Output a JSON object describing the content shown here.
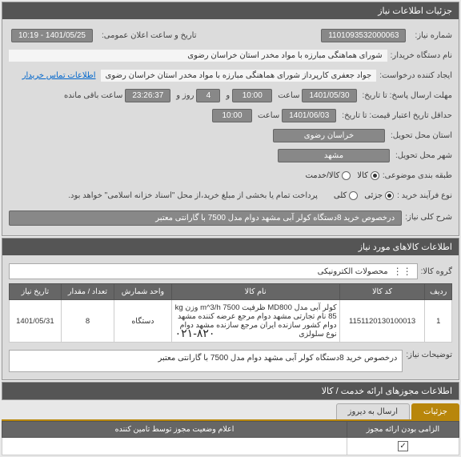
{
  "main_panel": {
    "title": "جزئیات اطلاعات نیاز"
  },
  "info": {
    "need_no_label": "شماره نیاز:",
    "need_no": "1101093532000063",
    "announce_label": "تاریخ و ساعت اعلان عمومی:",
    "announce_value": "1401/05/25 - 10:19",
    "buyer_label": "نام دستگاه خریدار:",
    "buyer_value": "شورای هماهنگی مبارزه با مواد مخدر استان خراسان رضوی",
    "creator_label": "ایجاد کننده درخواست:",
    "creator_value": "جواد جعفری کارپرداز شورای هماهنگی مبارزه با مواد مخدر استان خراسان رضوی",
    "contact_link": "اطلاعات تماس خریدار",
    "deadline_label": "مهلت ارسال پاسخ: تا تاریخ:",
    "deadline_date": "1401/05/30",
    "time_label": "ساعت",
    "deadline_time": "10:00",
    "days_left_pre": "و",
    "days_left": "4",
    "days_left_post": "روز و",
    "countdown": "23:26:37",
    "countdown_post": "ساعت باقی مانده",
    "credit_label": "حداقل تاریخ اعتبار قیمت: تا تاریخ:",
    "credit_date": "1401/06/03",
    "credit_time": "10:00",
    "province_label": "استان محل تحویل:",
    "province": "خراسان رضوی",
    "city_label": "شهر محل تحویل:",
    "city": "مشهد",
    "classify_label": "طبقه بندی موضوعی:",
    "classify_options": {
      "goods": "کالا",
      "service": "کالا/خدمت"
    },
    "buy_type_label": "نوع فرآیند خرید :",
    "buy_type_options": {
      "partial": "جزئی",
      "full": "کلی"
    },
    "buy_type_note": "پرداخت تمام یا بخشی از مبلغ خرید،از محل \"اسناد خزانه اسلامی\" خواهد بود.",
    "desc_label": "شرح کلی نیاز:",
    "desc_value": "درخصوص خرید 8دستگاه کولر آبی مشهد دوام  مدل 7500 با گارانتی معتبر"
  },
  "items_panel": {
    "title": "اطلاعات کالاهای مورد نیاز",
    "group_label": "گروه کالا:",
    "group_value": "محصولات الکترونیکی",
    "columns": {
      "row": "ردیف",
      "code": "کد کالا",
      "name": "نام کالا",
      "unit": "واحد شمارش",
      "qty": "تعداد / مقدار",
      "date": "تاریخ نیاز"
    },
    "rows": [
      {
        "row": "1",
        "code": "1151120130100013",
        "name": "کولر آبی مدل MD800 ظرفیت m^3/h 7500 وزن kg 85 نام تجارتی مشهد دوام مرجع عرضه کننده مشهد دوام کشور سازنده ایران مرجع سازنده مشهد دوام نوع سلولزی",
        "unit": "دستگاه",
        "qty": "8",
        "date": "1401/05/31"
      }
    ],
    "phone": "۰۲۱-۸۲۰",
    "notes_label": "توضیحات نیاز:",
    "notes_value": "درخصوص خرید 8دستگاه کولر آبی مشهد دوام  مدل 7500 با گارانتی معتبر"
  },
  "permits_panel": {
    "title": "اطلاعات مجوزهای ارائه خدمت / کالا"
  },
  "bottom": {
    "tabs": {
      "details": "جزئیات",
      "send": "ارسال به دیروز"
    },
    "col1": "الزامی بودن ارائه مجوز",
    "col2": "اعلام وضعیت مجوز توسط تامین کننده"
  }
}
